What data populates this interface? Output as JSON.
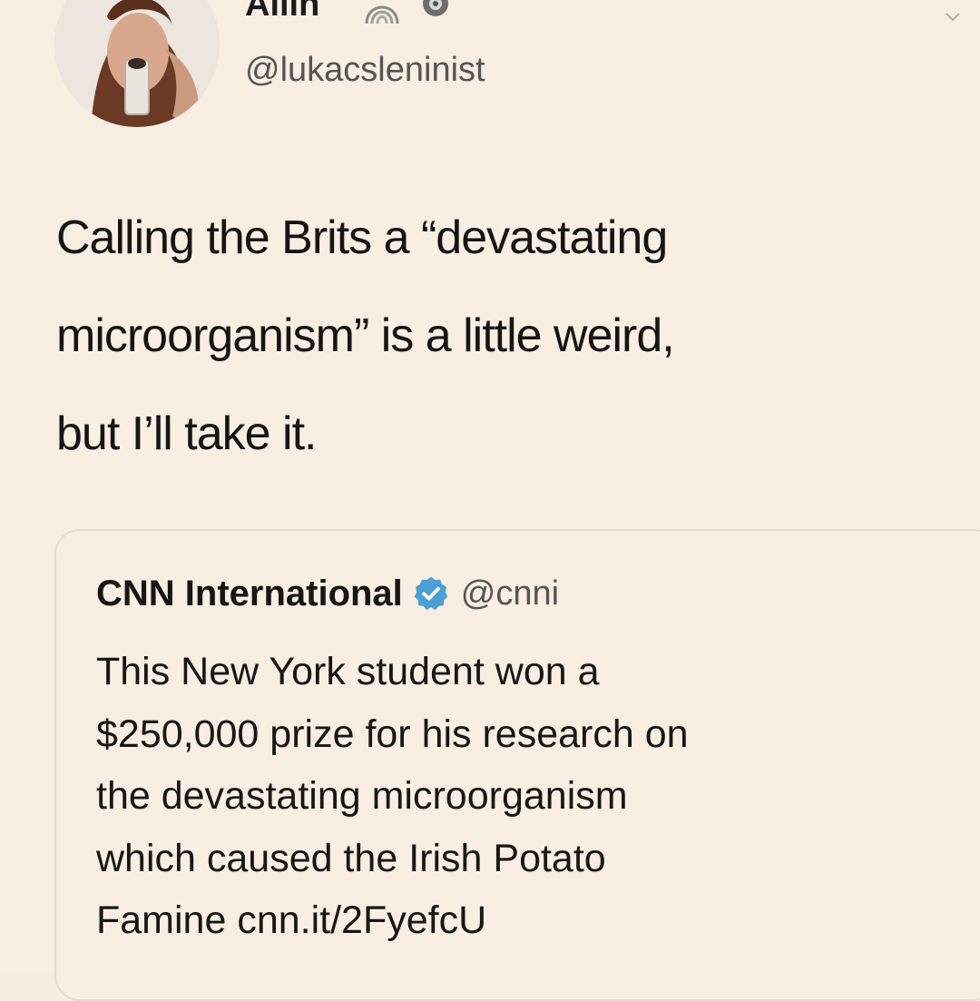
{
  "tweet": {
    "display_name": "Ailin",
    "handle": "@lukacsleninist",
    "text_lines": [
      "Calling the Brits a “devastating",
      "microorganism” is a little weird,",
      "but I’ll take it."
    ],
    "avatar_icon": "profile-photo",
    "name_emoji_icons": [
      "rainbow-icon",
      "gear-badge-icon"
    ],
    "menu_icon": "chevron-down-icon"
  },
  "quoted_tweet": {
    "display_name": "CNN International",
    "verified_icon": "verified-badge-icon",
    "handle": "@cnni",
    "text_lines": [
      "This New York student won a",
      "$250,000 prize for his research on",
      "the devastating microorganism",
      "which caused the Irish Potato",
      "Famine cnn.it/2FyefcU"
    ]
  },
  "colors": {
    "background": "#f8eee1",
    "text": "#151515",
    "secondary_text": "#555555",
    "verified_blue": "#1da1f2",
    "card_border": "#e6dccd"
  }
}
